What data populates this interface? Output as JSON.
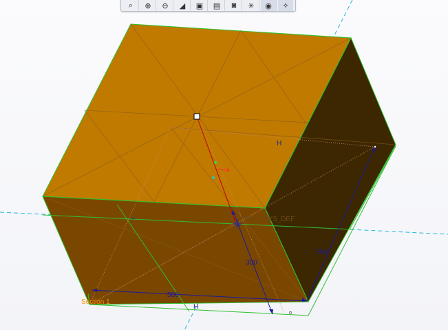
{
  "toolbar": {
    "tools": [
      {
        "icon": "zoom-fit-icon",
        "glyph": "⌕",
        "active": false
      },
      {
        "icon": "zoom-in-icon",
        "glyph": "⊕",
        "active": false
      },
      {
        "icon": "zoom-out-icon",
        "glyph": "⊖",
        "active": false
      },
      {
        "icon": "repaint-icon",
        "glyph": "◢",
        "active": false
      },
      {
        "icon": "orient-icon",
        "glyph": "▣",
        "active": false
      },
      {
        "icon": "saved-views-icon",
        "glyph": "▤",
        "active": false
      },
      {
        "icon": "camera-icon",
        "glyph": "◙",
        "active": false
      },
      {
        "icon": "datum-display-icon",
        "glyph": "✳",
        "active": false
      },
      {
        "icon": "display-style-icon",
        "glyph": "◉",
        "active": true
      },
      {
        "icon": "sketch-constraints-icon",
        "glyph": "⟡",
        "active": true
      }
    ]
  },
  "annotations": {
    "csys_label": "PRT_CSYS_DEF",
    "section_label": "Section 1",
    "dim_width": "500",
    "dim_depth": "500",
    "dim_height": "300",
    "h_marker_top": "H",
    "h_marker_bottom": "H"
  },
  "colors": {
    "top_face": "#c07a00",
    "front_face": "#7a4700",
    "right_face": "#3c2700",
    "edge_green": "#2fbf2f",
    "dim_blue": "#1a1a9a",
    "datum_cyan": "#22b8d8",
    "csys_red": "#c00000"
  }
}
